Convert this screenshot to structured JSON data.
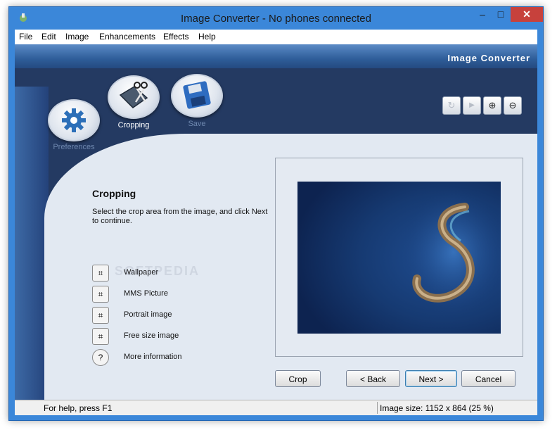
{
  "window": {
    "title": "Image Converter - No phones connected",
    "controls": {
      "minimize": "–",
      "maximize": "□",
      "close": "✕"
    }
  },
  "menu": [
    "File",
    "Edit",
    "Image",
    "Enhancements",
    "Effects",
    "Help"
  ],
  "banner": {
    "title": "Image Converter"
  },
  "steps": [
    {
      "label": "Preferences",
      "icon": "gear-icon",
      "state": "inactive"
    },
    {
      "label": "Cropping",
      "icon": "scissors-icon",
      "state": "active"
    },
    {
      "label": "Save",
      "icon": "floppy-disk-icon",
      "state": "inactive"
    }
  ],
  "toolbar": [
    {
      "name": "rotate-icon",
      "glyph": "↻",
      "enabled": false
    },
    {
      "name": "play-icon",
      "glyph": "▶",
      "enabled": false
    },
    {
      "name": "zoom-in-icon",
      "glyph": "⊕",
      "enabled": true
    },
    {
      "name": "zoom-out-icon",
      "glyph": "⊖",
      "enabled": true
    }
  ],
  "section": {
    "title": "Cropping",
    "instructions": "Select the crop area from the image, and click Next to continue."
  },
  "options": [
    {
      "label": "Wallpaper",
      "icon": "crop-icon"
    },
    {
      "label": "MMS Picture",
      "icon": "crop-icon"
    },
    {
      "label": "Portrait image",
      "icon": "crop-icon"
    },
    {
      "label": "Free size image",
      "icon": "crop-icon"
    },
    {
      "label": "More information",
      "icon": "help-icon"
    }
  ],
  "buttons": {
    "crop": "Crop",
    "back": "< Back",
    "next": "Next >",
    "cancel": "Cancel"
  },
  "status": {
    "help": "For help, press F1",
    "image_size": "Image size: 1152 x 864 (25 %)"
  },
  "watermark": "SOFTPEDIA",
  "colors": {
    "titlebar": "#3b87d9",
    "close": "#c7413c",
    "panel": "#e2e9f2",
    "dark": "#243a62"
  }
}
